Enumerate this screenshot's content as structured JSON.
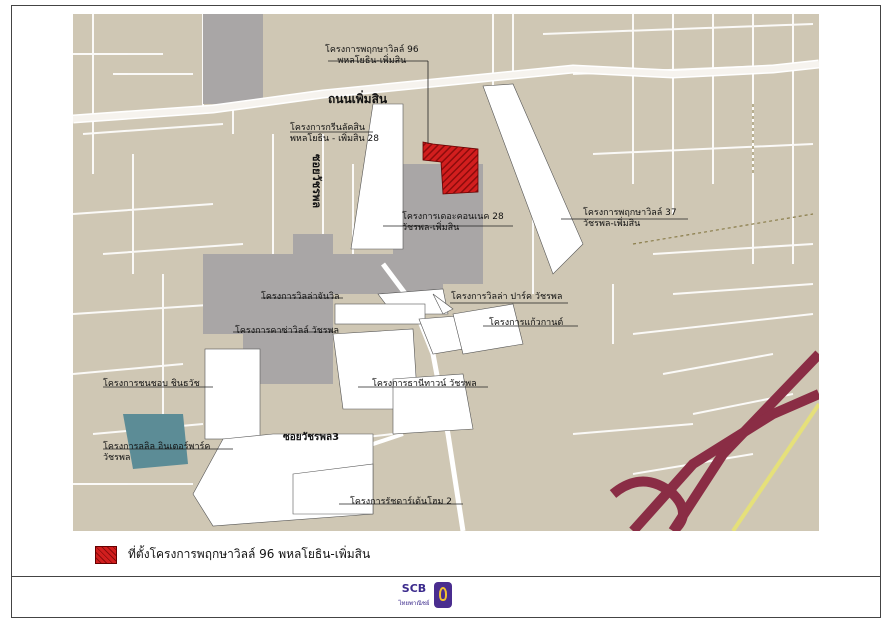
{
  "map": {
    "road_main": "ถนนเพิ่มสิน",
    "road_side_vertical": "ซอยวัชรพล",
    "road_bottom": "ซอยวัชรพล3",
    "labels": [
      "โครงการพฤกษาวิลล์ 96\nพหลโยธิน-เพิ่มสิน",
      "โครงการกรีนลัคสิน\nพหลโยธิน - เพิ่มสิน 28",
      "โครงการพฤกษาวิลล์ 37\nวัชรพล-เพิ่มสิน",
      "โครงการเดอะคอนเนค 28\nวัชรพล-เพิ่มสิน",
      "โครงการวิลล่าจันวิล",
      "โครงการวิลล่า ปาร์ค วัชรพล",
      "โครงการคาซ่าวิลล์ วัชรพล",
      "โครงการแก้วกานต์",
      "โครงการชนชอบ ชินธวัช",
      "โครงการธานีทาวน์ วัชรพล",
      "โครงการลลิล อินเตอร์พาร์ค\nวัชรพล",
      "โครงการรัชดาร์เด้นโฮม 2"
    ]
  },
  "legend": {
    "text": "ที่ตั้งโครงการพฤกษาวิลล์ 96 พหลโยธิน-เพิ่มสิน",
    "color": "#d21e1e"
  },
  "logo": {
    "name": "SCB",
    "sub": "ไทยพาณิชย์",
    "color": "#4a2d8f"
  }
}
